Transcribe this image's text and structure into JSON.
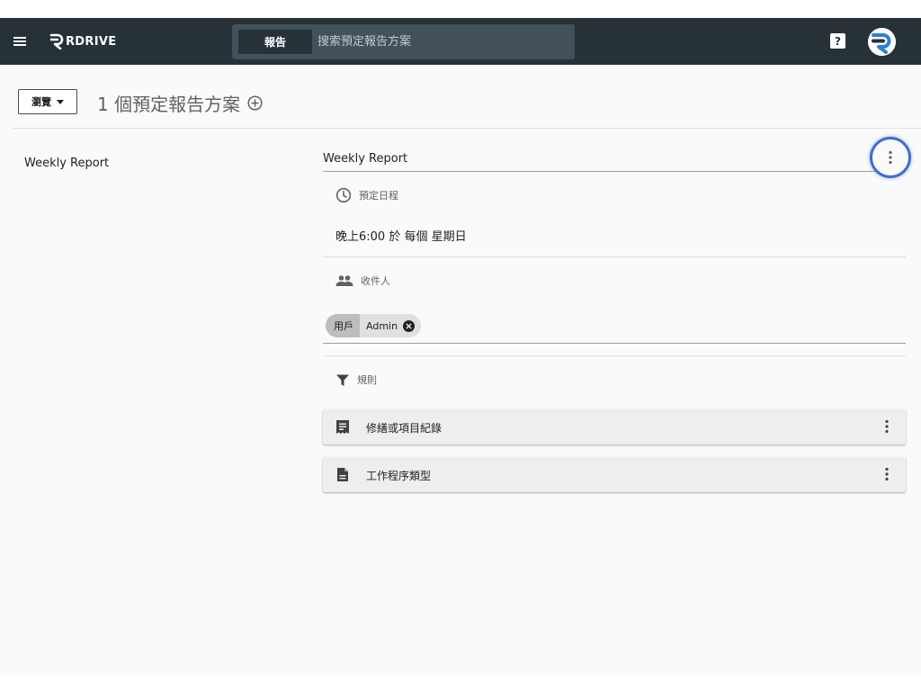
{
  "app": {
    "logo_text": "RDRIVE",
    "search_chip_label": "報告",
    "search_placeholder": "搜索預定報告方案",
    "help_glyph": "?",
    "icons": [
      "menu-icon",
      "rdrive-logo-icon",
      "help-icon",
      "avatar-logo-icon"
    ],
    "colors": {
      "topbar": "#263238",
      "search_bg": "#44505a",
      "avatar_accent": "#2f7fd6",
      "focus_ring": "#3d6fd4",
      "content_bg": "#fafafa"
    }
  },
  "toolbar": {
    "browse_label": "瀏覽",
    "count_title": "1 個預定報告方案"
  },
  "list": {
    "items": [
      "Weekly Report"
    ]
  },
  "detail": {
    "name_value": "Weekly Report",
    "schedule": {
      "label": "預定日程",
      "value": "晚上6:00 於 每個 星期日"
    },
    "recipients": {
      "label": "收件人",
      "chips": [
        {
          "type": "用戶",
          "name": "Admin"
        }
      ]
    },
    "rules": {
      "label": "規則",
      "items": [
        {
          "icon": "receipt-icon",
          "label": "修繕或項目紀錄"
        },
        {
          "icon": "document-icon",
          "label": "工作程序類型"
        }
      ]
    }
  }
}
